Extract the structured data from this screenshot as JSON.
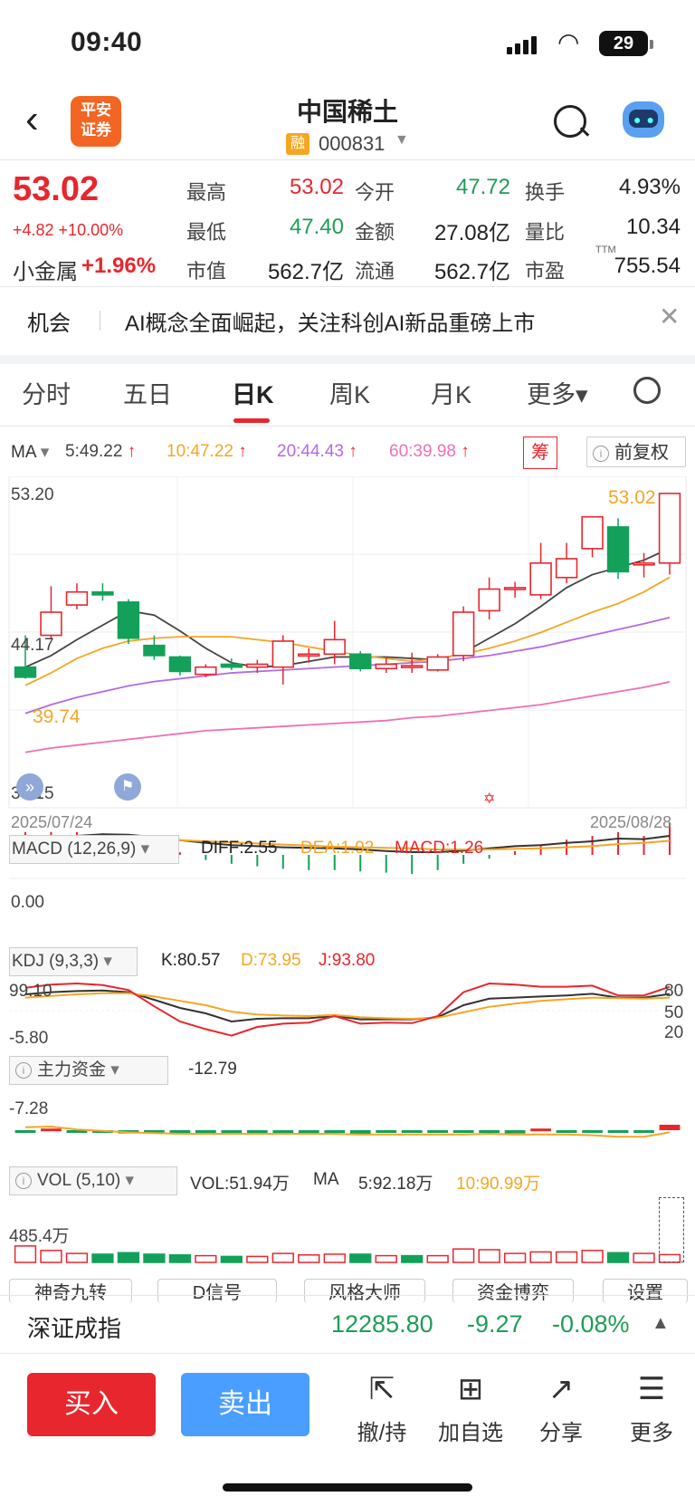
{
  "status_bar": {
    "time": "09:40",
    "battery": "29"
  },
  "header": {
    "back_icon": "chevron-left-icon",
    "logo_line1": "平安",
    "logo_line2": "证券",
    "stock_name": "中国稀土",
    "rong_badge": "融",
    "stock_code": "000831",
    "search_icon": "search-icon",
    "assistant_icon": "robot-icon"
  },
  "quote": {
    "last_price": "53.02",
    "change": "+4.82 +10.00%",
    "sector_name": "小金属",
    "sector_change": "+1.96%",
    "fields": [
      {
        "label": "最高",
        "value": "53.02",
        "color": "#e8262d"
      },
      {
        "label": "今开",
        "value": "47.72",
        "color": "#1f9d55"
      },
      {
        "label": "换手",
        "value": "4.93%",
        "color": "#222222"
      },
      {
        "label": "最低",
        "value": "47.40",
        "color": "#1f9d55"
      },
      {
        "label": "金额",
        "value": "27.08亿",
        "color": "#222222"
      },
      {
        "label": "量比",
        "value": "10.34",
        "color": "#222222"
      },
      {
        "label": "市值",
        "value": "562.7亿",
        "color": "#222222"
      },
      {
        "label": "流通",
        "value": "562.7亿",
        "color": "#222222"
      },
      {
        "label": "市盈",
        "value": "755.54",
        "color": "#222222"
      }
    ],
    "ttm_tag": "TTM"
  },
  "news": {
    "tag": "机会",
    "text": "AI概念全面崛起，关注科创AI新品重磅上市",
    "close_icon": "close-icon"
  },
  "tabs": [
    "分时",
    "五日",
    "日K",
    "周K",
    "月K",
    "更多"
  ],
  "active_tab": "日K",
  "kline": {
    "ma_label": "MA",
    "ma": [
      {
        "text": "5:49.22",
        "color": "#444444"
      },
      {
        "text": "10:47.22",
        "color": "#f5a623"
      },
      {
        "text": "20:44.43",
        "color": "#b36ae2"
      },
      {
        "text": "60:39.98",
        "color": "#ef6fb6"
      }
    ],
    "chou_label": "筹",
    "adjust_label": "前复权",
    "y_top": "53.20",
    "y_mid": "44.17",
    "y_bottom": "35.15",
    "max_label": "53.02",
    "min_label": "39.74",
    "date_start": "2025/07/24",
    "date_end": "2025/08/28"
  },
  "chart_data": [
    {
      "type": "candlestick",
      "title": "日K",
      "x": [
        "2025/07/24",
        "",
        "",
        "",
        "",
        "",
        "",
        "",
        "",
        "",
        "",
        "",
        "",
        "",
        "",
        "",
        "",
        "",
        "",
        "",
        "",
        "",
        "",
        "",
        "",
        "2025/08/28"
      ],
      "ohlc": [
        [
          41.0,
          43.2,
          40.2,
          40.3
        ],
        [
          43.2,
          46.6,
          43.0,
          44.8
        ],
        [
          45.3,
          46.8,
          45.0,
          46.2
        ],
        [
          46.2,
          46.8,
          45.6,
          46.0
        ],
        [
          45.5,
          45.7,
          42.6,
          43.0
        ],
        [
          42.5,
          43.2,
          41.5,
          41.8
        ],
        [
          41.7,
          41.8,
          40.4,
          40.7
        ],
        [
          40.5,
          41.2,
          40.3,
          41.0
        ],
        [
          41.2,
          41.6,
          40.8,
          41.0
        ],
        [
          41.0,
          41.5,
          40.6,
          41.2
        ],
        [
          41.0,
          43.2,
          39.8,
          42.8
        ],
        [
          41.8,
          42.3,
          41.3,
          41.9
        ],
        [
          41.9,
          44.2,
          41.2,
          42.9
        ],
        [
          41.9,
          42.1,
          40.7,
          40.9
        ],
        [
          40.9,
          41.7,
          40.6,
          41.2
        ],
        [
          41.0,
          42.0,
          40.6,
          41.1
        ],
        [
          40.8,
          41.9,
          40.7,
          41.7
        ],
        [
          41.8,
          45.2,
          41.4,
          44.8
        ],
        [
          44.9,
          47.2,
          44.3,
          46.4
        ],
        [
          46.4,
          46.9,
          45.8,
          46.5
        ],
        [
          46.0,
          49.6,
          45.7,
          48.2
        ],
        [
          47.2,
          49.6,
          46.8,
          48.5
        ],
        [
          49.2,
          50.7,
          48.6,
          51.4
        ],
        [
          50.7,
          51.3,
          47.1,
          47.6
        ],
        [
          48.2,
          48.9,
          47.2,
          48.2
        ],
        [
          48.2,
          53.02,
          47.4,
          53.02
        ]
      ],
      "series": [
        {
          "name": "MA5",
          "values": [
            41.0,
            41.8,
            42.9,
            43.9,
            44.9,
            44.6,
            43.5,
            42.3,
            41.3,
            41.0,
            41.1,
            41.4,
            41.7,
            41.7,
            41.7,
            41.6,
            41.5,
            42.0,
            43.0,
            44.0,
            45.2,
            46.5,
            47.4,
            47.9,
            48.4,
            49.22
          ]
        },
        {
          "name": "MA10",
          "values": [
            39.74,
            40.6,
            41.6,
            42.3,
            42.8,
            43.0,
            43.1,
            43.1,
            43.1,
            42.9,
            42.7,
            42.4,
            42.1,
            41.8,
            41.6,
            41.4,
            41.6,
            41.9,
            42.3,
            42.8,
            43.4,
            44.1,
            44.8,
            45.4,
            46.2,
            47.22
          ]
        },
        {
          "name": "MA20",
          "values": [
            37.8,
            38.4,
            38.9,
            39.3,
            39.7,
            40.0,
            40.2,
            40.4,
            40.6,
            40.7,
            40.8,
            40.9,
            41.0,
            41.1,
            41.2,
            41.3,
            41.4,
            41.6,
            41.8,
            42.1,
            42.4,
            42.8,
            43.2,
            43.6,
            44.0,
            44.43
          ]
        },
        {
          "name": "MA60",
          "values": [
            35.1,
            35.4,
            35.6,
            35.8,
            36.0,
            36.2,
            36.4,
            36.6,
            36.7,
            36.8,
            36.9,
            37.0,
            37.1,
            37.2,
            37.3,
            37.5,
            37.6,
            37.8,
            38.0,
            38.2,
            38.4,
            38.7,
            39.0,
            39.3,
            39.6,
            39.98
          ]
        }
      ],
      "ylim": [
        35.15,
        53.2
      ]
    },
    {
      "type": "bar",
      "title": "MACD (12,26,9)",
      "values": [
        0.9,
        0.9,
        0.9,
        0.85,
        0.7,
        0.4,
        0.1,
        -0.2,
        -0.35,
        -0.45,
        -0.55,
        -0.6,
        -0.6,
        -0.65,
        -0.7,
        -0.75,
        -0.6,
        -0.35,
        -0.15,
        0.15,
        0.35,
        0.6,
        0.75,
        0.9,
        0.75,
        1.26
      ],
      "series": [
        {
          "name": "DIFF",
          "values": [
            2.2,
            2.7,
            2.95,
            3.1,
            3.05,
            2.85,
            2.55,
            2.3,
            2.1,
            2.0,
            1.9,
            1.85,
            1.8,
            1.7,
            1.55,
            1.45,
            1.45,
            1.6,
            1.8,
            2.0,
            2.1,
            2.3,
            2.45,
            2.7,
            2.65,
            2.95
          ]
        },
        {
          "name": "DEA",
          "values": [
            1.8,
            2.0,
            2.25,
            2.45,
            2.55,
            2.6,
            2.55,
            2.45,
            2.35,
            2.25,
            2.15,
            2.05,
            1.95,
            1.9,
            1.85,
            1.8,
            1.7,
            1.7,
            1.7,
            1.75,
            1.8,
            1.9,
            2.0,
            2.2,
            2.3,
            2.5
          ]
        }
      ],
      "diff": "2.55",
      "dea": "1.92",
      "macd": "1.26",
      "y_label": "0.00"
    },
    {
      "type": "line",
      "title": "KDJ (9,3,3)",
      "series": [
        {
          "name": "K",
          "values": [
            80,
            84,
            86,
            87,
            84,
            70,
            55,
            45,
            30,
            35,
            36,
            36,
            40,
            34,
            34,
            34,
            38,
            60,
            72,
            74,
            76,
            78,
            81,
            74,
            74,
            80.57
          ]
        },
        {
          "name": "D",
          "values": [
            74,
            77,
            80,
            82,
            82,
            76,
            68,
            60,
            48,
            43,
            41,
            40,
            42,
            38,
            36,
            35,
            37,
            47,
            57,
            63,
            68,
            71,
            74,
            73,
            72,
            73.95
          ]
        },
        {
          "name": "J",
          "values": [
            92,
            98,
            100,
            97,
            88,
            58,
            30,
            16,
            4,
            20,
            26,
            28,
            40,
            26,
            28,
            27,
            40,
            84,
            100,
            98,
            94,
            94,
            96,
            78,
            78,
            93.8
          ]
        }
      ],
      "k": "80.57",
      "d": "73.95",
      "j": "93.80",
      "y_top": "99.10",
      "y_bottom": "-5.80",
      "right_ticks": [
        "80",
        "50",
        "20"
      ]
    },
    {
      "type": "bar",
      "title": "主力资金",
      "value": "-12.79",
      "y_top": "-7.28",
      "values": [
        -0.5,
        0.3,
        -0.4,
        -0.5,
        -0.6,
        -0.5,
        -0.4,
        -0.4,
        -0.4,
        -0.4,
        -0.4,
        -0.4,
        -0.3,
        -0.8,
        -0.5,
        -0.5,
        -0.4,
        -0.4,
        -0.4,
        -0.6,
        0.3,
        -0.5,
        -0.4,
        -0.3,
        -0.4,
        1.0
      ],
      "series": [
        {
          "name": "line",
          "values": [
            0.4,
            0.5,
            0.1,
            -0.1,
            -0.3,
            -0.4,
            -0.5,
            -0.5,
            -0.5,
            -0.5,
            -0.5,
            -0.5,
            -0.5,
            -0.6,
            -0.6,
            -0.6,
            -0.6,
            -0.6,
            -0.5,
            -0.6,
            -0.6,
            -0.6,
            -0.7,
            -0.9,
            -0.9,
            -0.3
          ]
        }
      ]
    },
    {
      "type": "bar",
      "title": "VOL (5,10)",
      "vol": "VOL:51.94万",
      "ma_label": "MA",
      "ma5": "5:92.18万",
      "ma10": "10:90.99万",
      "y_top": "485.4万",
      "values": [
        110,
        80,
        60,
        55,
        65,
        55,
        50,
        45,
        40,
        40,
        60,
        50,
        55,
        55,
        45,
        45,
        45,
        90,
        85,
        60,
        70,
        70,
        80,
        65,
        60,
        51.94
      ],
      "up": [
        true,
        true,
        true,
        false,
        false,
        false,
        false,
        true,
        false,
        true,
        true,
        true,
        true,
        false,
        true,
        false,
        true,
        true,
        true,
        true,
        true,
        true,
        true,
        false,
        true,
        true
      ]
    }
  ],
  "indicators": {
    "macd_label": "MACD (12,26,9)",
    "macd_diff": "DIFF:2.55",
    "macd_dea": "DEA:1.92",
    "macd_val": "MACD:1.26",
    "macd_y": "0.00",
    "kdj_label": "KDJ (9,3,3)",
    "kdj_k": "K:80.57",
    "kdj_d": "D:73.95",
    "kdj_j": "J:93.80",
    "kdj_top": "99.10",
    "kdj_bottom": "-5.80",
    "kdj_r80": "80",
    "kdj_r50": "50",
    "kdj_r20": "20",
    "fund_label": "主力资金",
    "fund_value": "-12.79",
    "fund_top": "-7.28",
    "vol_label": "VOL (5,10)",
    "vol_value": "VOL:51.94万",
    "vol_ma": "MA",
    "vol_ma5": "5:92.18万",
    "vol_ma10": "10:90.99万",
    "vol_top": "485.4万"
  },
  "tools": [
    "神奇九转",
    "D信号",
    "风格大师",
    "资金博弈",
    "设置"
  ],
  "index": {
    "name": "深证成指",
    "value": "12285.80",
    "change": "-9.27",
    "pct": "-0.08%"
  },
  "actions": {
    "buy": "买入",
    "sell": "卖出",
    "items": [
      {
        "label": "撤/持",
        "icon": "cancel-order-icon"
      },
      {
        "label": "加自选",
        "icon": "add-watchlist-icon"
      },
      {
        "label": "分享",
        "icon": "share-icon"
      },
      {
        "label": "更多",
        "icon": "menu-icon"
      }
    ]
  }
}
